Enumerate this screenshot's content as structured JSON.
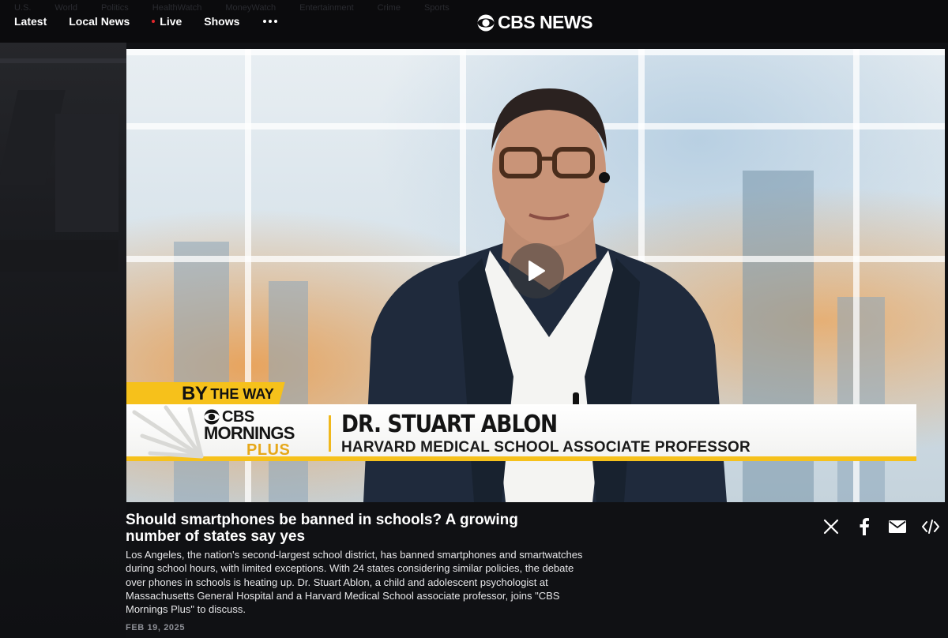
{
  "nav": {
    "ghost_items": [
      "U.S.",
      "World",
      "Politics",
      "HealthWatch",
      "MoneyWatch",
      "Entertainment",
      "Crime",
      "Sports"
    ],
    "items": [
      {
        "label": "Latest"
      },
      {
        "label": "Local News"
      },
      {
        "label": "Live"
      },
      {
        "label": "Shows"
      }
    ],
    "more_icon": "more-dots-icon",
    "brand": "CBS NEWS"
  },
  "video": {
    "play_icon": "play-icon",
    "lower_third": {
      "tab_big": "BY",
      "tab_small": "THE WAY",
      "show_line1": "CBS",
      "show_line2": "MORNINGS",
      "show_line3": "PLUS",
      "name": "DR. STUART ABLON",
      "role": "HARVARD MEDICAL SCHOOL ASSOCIATE PROFESSOR"
    }
  },
  "article": {
    "headline": "Should smartphones be banned in schools? A growing number of states say yes",
    "summary": "Los Angeles, the nation's second-largest school district, has banned smartphones and smartwatches during school hours, with limited exceptions. With 24 states considering similar policies, the debate over phones in schools is heating up. Dr. Stuart Ablon, a child and adolescent psychologist at Massachusetts General Hospital and a Harvard Medical School associate professor, joins \"CBS Mornings Plus\" to discuss.",
    "date": "FEB 19, 2025"
  },
  "share": [
    "x-icon",
    "facebook-icon",
    "email-icon",
    "embed-icon"
  ],
  "colors": {
    "accent_yellow": "#f6c11b",
    "live_red": "#e3262c",
    "background": "#101114"
  }
}
